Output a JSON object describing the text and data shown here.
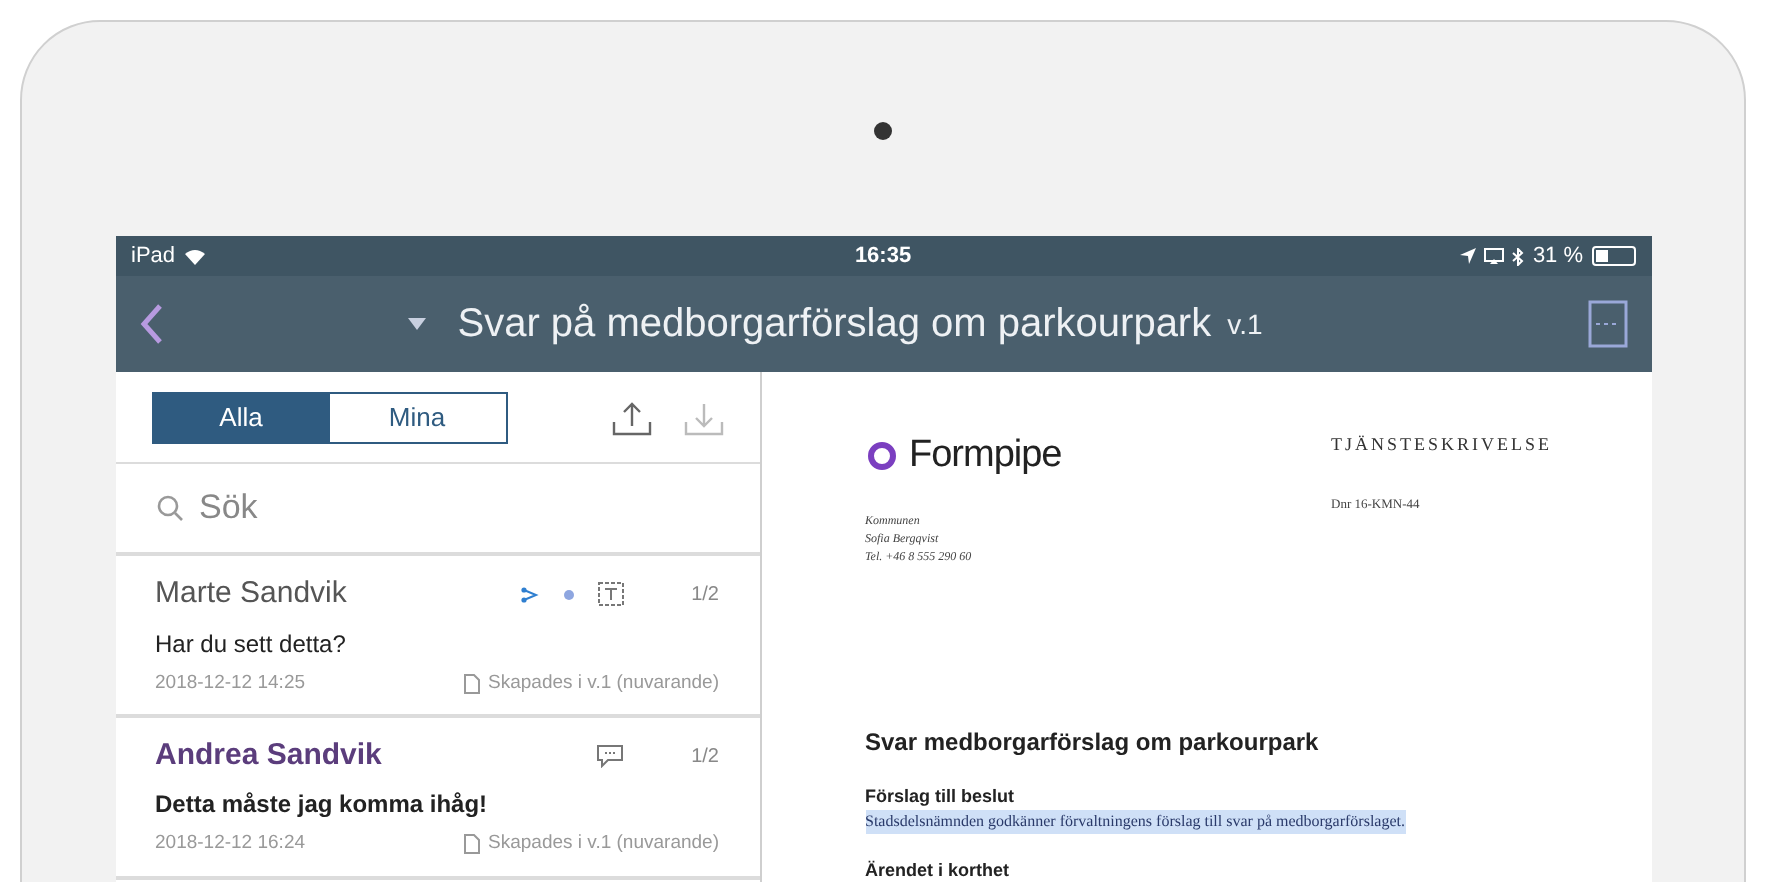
{
  "status_bar": {
    "carrier": "iPad",
    "time": "16:35",
    "battery": "31 %"
  },
  "nav": {
    "title": "Svar på medborgarförslag om parkourpark",
    "version": "v.1"
  },
  "segments": [
    {
      "label": "Alla",
      "selected": true
    },
    {
      "label": "Mina",
      "selected": false
    }
  ],
  "search": {
    "placeholder": "Sök"
  },
  "comments": [
    {
      "kind": "annotation",
      "author": "Marte Sandvik",
      "unread": false,
      "text": "Har du sett detta?",
      "page": "1/2",
      "date": "2018-12-12 14:25",
      "source": "Skapades i v.1 (nuvarande)"
    },
    {
      "kind": "comment",
      "author": "Andrea Sandvik",
      "unread": true,
      "text": "Detta måste jag komma ihåg!",
      "page": "1/2",
      "date": "2018-12-12 16:24",
      "source": "Skapades i v.1 (nuvarande)"
    }
  ],
  "document": {
    "logo": "Formpipe",
    "doc_type": "TJÄNSTESKRIVELSE",
    "dnr": "Dnr 16-KMN-44",
    "contact": [
      "Kommunen",
      "Sofia Bergqvist",
      "Tel. +46 8 555 290 60"
    ],
    "heading": "Svar medborgarförslag om parkourpark",
    "sections": [
      {
        "heading": "Förslag till beslut",
        "text": "Stadsdelsnämnden godkänner förvaltningens förslag till svar på medborgarförslaget.",
        "highlighted": true
      },
      {
        "heading": "Ärendet i korthet"
      }
    ]
  }
}
